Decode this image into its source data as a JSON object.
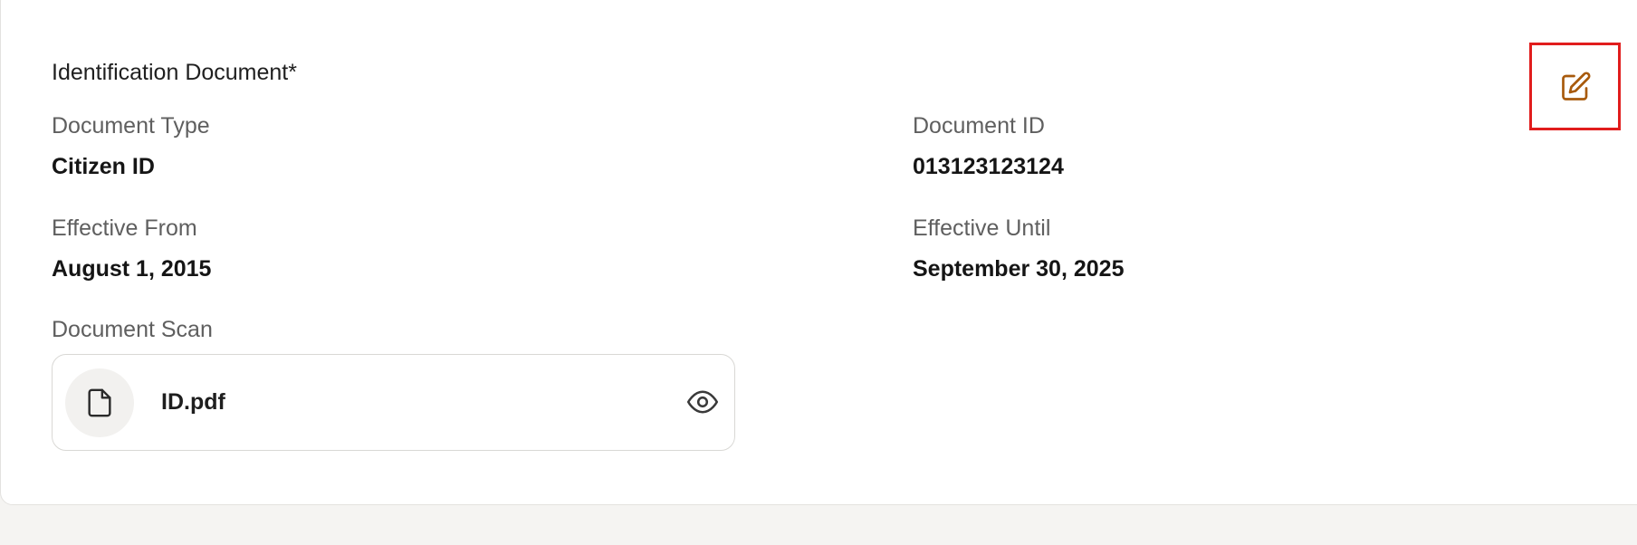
{
  "section": {
    "title": "Identification Document*"
  },
  "fields": {
    "document_type": {
      "label": "Document Type",
      "value": "Citizen ID"
    },
    "document_id": {
      "label": "Document ID",
      "value": "013123123124"
    },
    "effective_from": {
      "label": "Effective From",
      "value": "August 1, 2015"
    },
    "effective_until": {
      "label": "Effective Until",
      "value": "September 30, 2025"
    }
  },
  "scan": {
    "label": "Document Scan",
    "file_name": "ID.pdf",
    "file_icon": "file-icon",
    "view_icon": "eye-icon"
  },
  "actions": {
    "edit_icon": "pencil-edit-icon"
  },
  "colors": {
    "edit_icon": "#a85a0c",
    "highlight_border": "#e11d1d",
    "background": "#f5f4f2",
    "card": "#ffffff"
  }
}
